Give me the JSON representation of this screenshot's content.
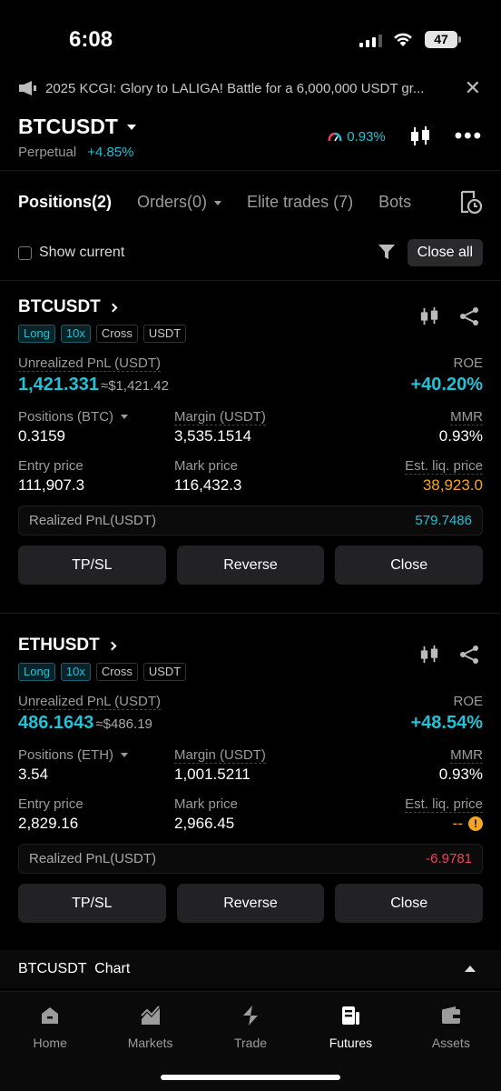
{
  "status_bar": {
    "time": "6:08",
    "battery": "47"
  },
  "announcement": {
    "text": "2025 KCGI: Glory to LALIGA! Battle for a 6,000,000 USDT gr..."
  },
  "header": {
    "pair": "BTCUSDT",
    "contract_type": "Perpetual",
    "change": "+4.85%",
    "funding_rate": "0.93%"
  },
  "tabs": [
    {
      "label": "Positions(2)",
      "active": true
    },
    {
      "label": "Orders(0)",
      "active": false
    },
    {
      "label": "Elite trades (7)",
      "active": false
    },
    {
      "label": "Bots",
      "active": false
    }
  ],
  "filter": {
    "show_current_label": "Show current",
    "close_all_label": "Close all"
  },
  "positions": [
    {
      "symbol": "BTCUSDT",
      "tags": [
        "Long",
        "10x",
        "Cross",
        "USDT"
      ],
      "unrealized_label": "Unrealized PnL (USDT)",
      "unrealized_value": "1,421.331",
      "unrealized_approx": "≈$1,421.42",
      "roe_label": "ROE",
      "roe_value": "+40.20%",
      "positions_label": "Positions (BTC)",
      "positions_value": "0.3159",
      "margin_label": "Margin (USDT)",
      "margin_value": "3,535.1514",
      "mmr_label": "MMR",
      "mmr_value": "0.93%",
      "entry_label": "Entry price",
      "entry_value": "111,907.3",
      "mark_label": "Mark price",
      "mark_value": "116,432.3",
      "liq_label": "Est. liq. price",
      "liq_value": "38,923.0",
      "realized_label": "Realized PnL(USDT)",
      "realized_value": "579.7486"
    },
    {
      "symbol": "ETHUSDT",
      "tags": [
        "Long",
        "10x",
        "Cross",
        "USDT"
      ],
      "unrealized_label": "Unrealized PnL (USDT)",
      "unrealized_value": "486.1643",
      "unrealized_approx": "≈$486.19",
      "roe_label": "ROE",
      "roe_value": "+48.54%",
      "positions_label": "Positions (ETH)",
      "positions_value": "3.54",
      "margin_label": "Margin (USDT)",
      "margin_value": "1,001.5211",
      "mmr_label": "MMR",
      "mmr_value": "0.93%",
      "entry_label": "Entry price",
      "entry_value": "2,829.16",
      "mark_label": "Mark price",
      "mark_value": "2,966.45",
      "liq_label": "Est. liq. price",
      "liq_value": "--",
      "warn_glyph": "!",
      "realized_label": "Realized PnL(USDT)",
      "realized_value": "-6.9781"
    }
  ],
  "buttons": {
    "tpsl": "TP/SL",
    "reverse": "Reverse",
    "close": "Close"
  },
  "chart_bar": {
    "label": "BTCUSDT  Chart"
  },
  "bottom_nav": [
    {
      "label": "Home",
      "icon": "home-icon"
    },
    {
      "label": "Markets",
      "icon": "markets-icon"
    },
    {
      "label": "Trade",
      "icon": "trade-icon"
    },
    {
      "label": "Futures",
      "icon": "futures-icon",
      "active": true
    },
    {
      "label": "Assets",
      "icon": "wallet-icon"
    }
  ],
  "colors": {
    "accent": "#22c1d6",
    "warning": "#f5a623",
    "negative": "#f0435a",
    "background": "#000000"
  }
}
